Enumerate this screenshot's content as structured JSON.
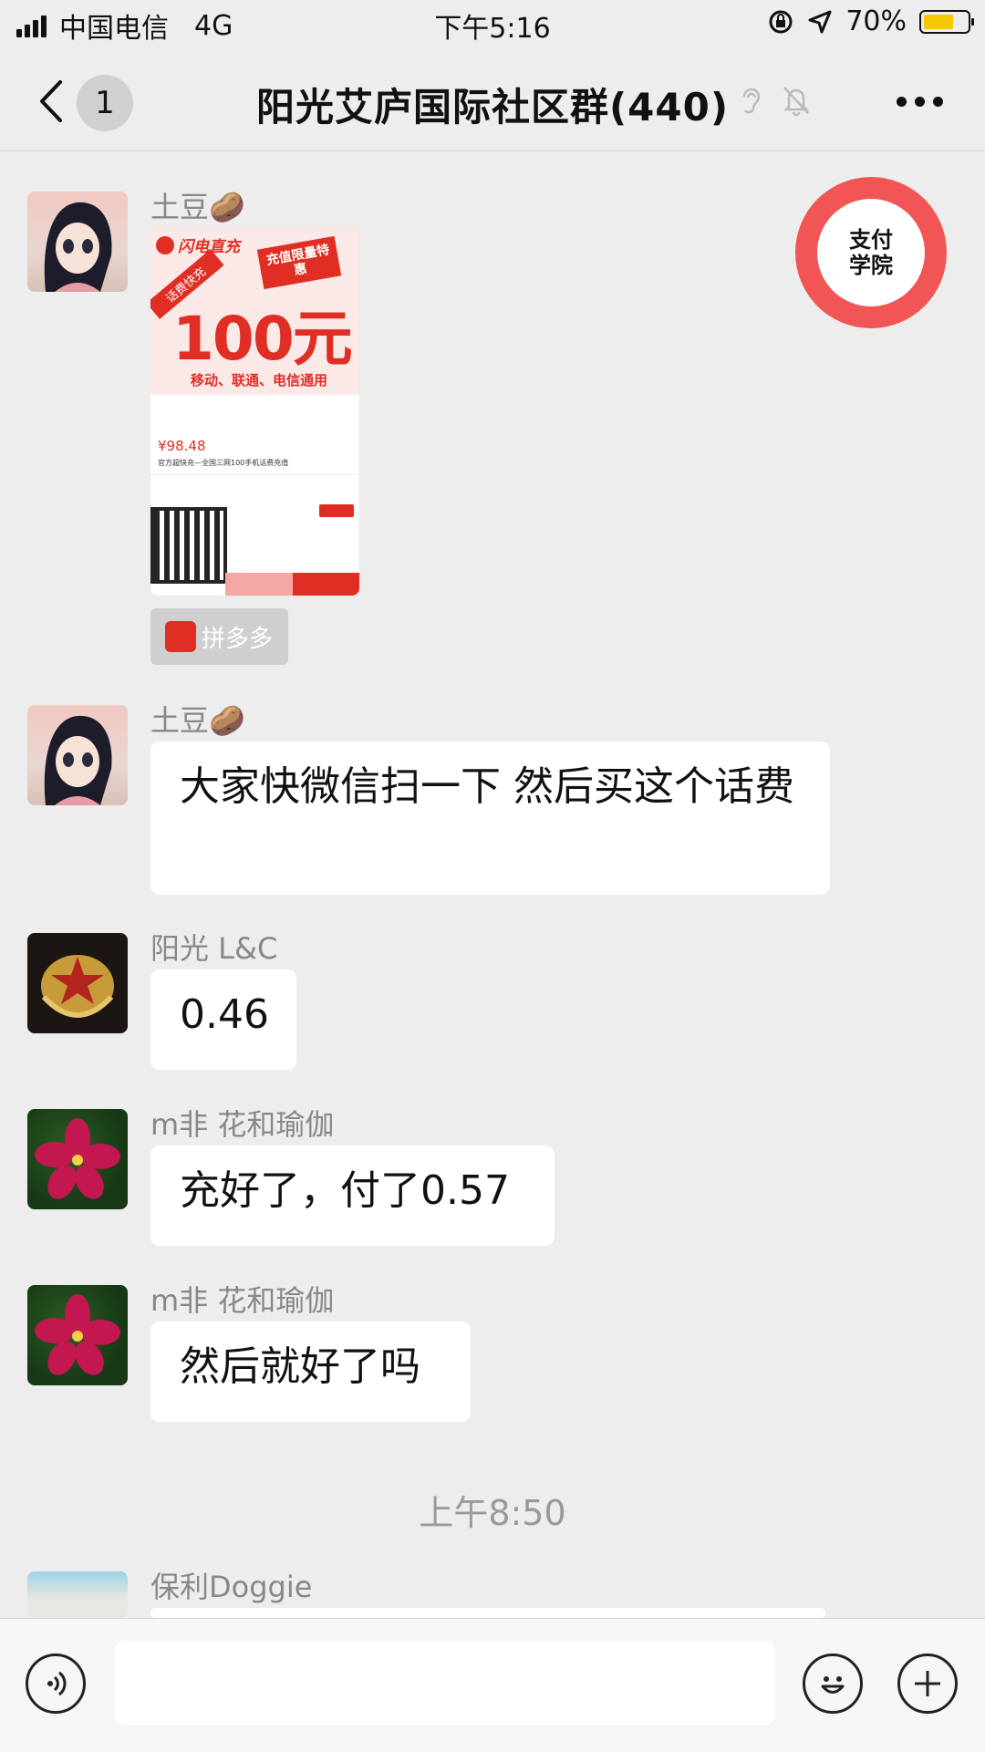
{
  "status_bar": {
    "carrier": "中国电信",
    "network": "4G",
    "time": "下午5:16",
    "battery_percent": "70%",
    "battery_level": 0.7
  },
  "nav": {
    "back_count": "1",
    "title": "阳光艾庐国际社区群(440)"
  },
  "messages": [
    {
      "sender": "土豆🥔",
      "type": "image"
    },
    {
      "sender": "土豆🥔",
      "text": "大家快微信扫一下 然后买这个话费"
    },
    {
      "sender": "阳光  L&C",
      "text": "0.46"
    },
    {
      "sender": "m非 花和瑜伽",
      "text": "充好了，付了0.57"
    },
    {
      "sender": "m非 花和瑜伽",
      "text": "然后就好了吗"
    },
    {
      "sender": "保利Doggie",
      "text": ""
    }
  ],
  "timestamp": "上午8:50",
  "ad": {
    "brand": "闪电直充",
    "tag": "话费快充",
    "promo": "充值限量特惠",
    "amount": "100元",
    "carriers": "移动、联通、电信通用",
    "price": "¥98.48",
    "desc": "官方超快充—全国三网100手机话费充值"
  },
  "pdd_label": "拼多多",
  "float_logo_text": "支付学院",
  "colors": {
    "bubble": "#ffffff",
    "background": "#ededed",
    "accent_red": "#e02e24"
  }
}
